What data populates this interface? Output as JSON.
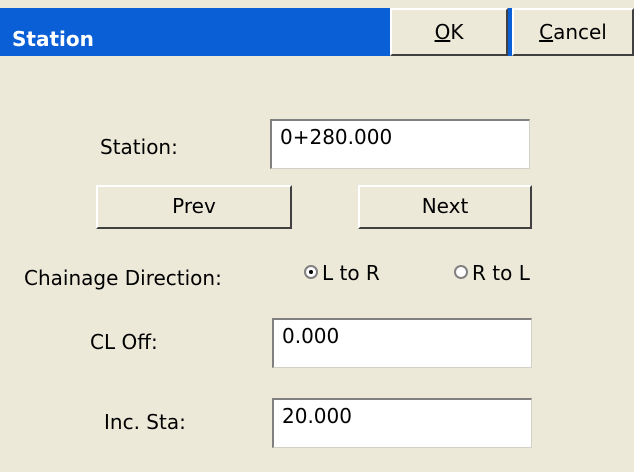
{
  "dialog": {
    "title": "Station",
    "ok": {
      "accel": "O",
      "rest": "K"
    },
    "cancel": {
      "accel": "C",
      "rest": "ancel"
    }
  },
  "form": {
    "station_label": "Station:",
    "station_value": "0+280.000",
    "prev_label": "Prev",
    "next_label": "Next",
    "direction_label": "Chainage Direction:",
    "direction_options": [
      "L to R",
      "R to L"
    ],
    "direction_selected": "L to R",
    "cl_off_label": "CL Off:",
    "cl_off_value": "0.000",
    "inc_sta_label": "Inc. Sta:",
    "inc_sta_value": "20.000"
  }
}
